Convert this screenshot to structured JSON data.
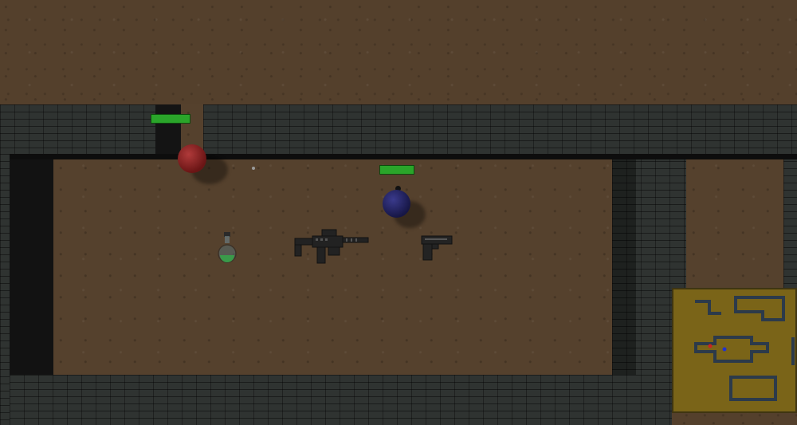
{
  "colors": {
    "ground": "#54402c",
    "wall": "#2f3331",
    "health": "#2aa52a",
    "enemy": "#8a2222",
    "player": "#23235f",
    "minimap_bg": "#7a6418",
    "minimap_wall": "#2c3a4a",
    "minimap_enemy": "#cc2222",
    "minimap_player": "#2233cc"
  },
  "entities": {
    "enemy": {
      "type": "enemy-ball",
      "health": 1.0
    },
    "player": {
      "type": "player-ball",
      "health": 1.0
    }
  },
  "pickups": [
    {
      "type": "potion-icon",
      "color": "#3a9a4a"
    },
    {
      "type": "assault-rifle-icon"
    },
    {
      "type": "pistol-icon"
    }
  ],
  "minimap": {
    "visible": true
  }
}
